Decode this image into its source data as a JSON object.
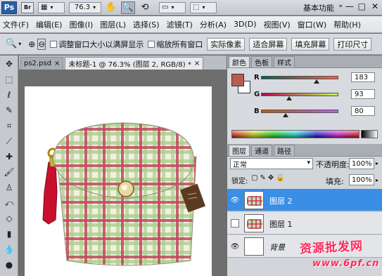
{
  "appbar": {
    "logo": "Ps",
    "bridge": "Br",
    "zoom": "76.3",
    "workspace": "基本功能",
    "minimize": "—",
    "maximize": "□",
    "close": "✕"
  },
  "menu": [
    "文件(F)",
    "编辑(E)",
    "图像(I)",
    "图层(L)",
    "选择(S)",
    "滤镜(T)",
    "分析(A)",
    "3D(D)",
    "视图(V)",
    "窗口(W)",
    "帮助(H)"
  ],
  "options": {
    "check1_label": "调整窗口大小以满屏显示",
    "check2_label": "缩放所有窗口",
    "btn_actual": "实际像素",
    "btn_fit": "适合屏幕",
    "btn_fill": "填充屏幕",
    "btn_print": "打印尺寸"
  },
  "tools": [
    "move-tool",
    "marquee-tool",
    "lasso-tool",
    "quick-select-tool",
    "crop-tool",
    "eyedropper-tool",
    "healing-tool",
    "brush-tool",
    "clone-stamp-tool",
    "history-brush-tool",
    "eraser-tool",
    "gradient-tool",
    "blur-tool",
    "dodge-tool"
  ],
  "doc_tabs": [
    {
      "label": "ps2.psd"
    },
    {
      "label": "未标题-1 @ 76.3% (图层 2, RGB/8) *"
    }
  ],
  "color_panel": {
    "tabs": [
      "颜色",
      "色板",
      "样式"
    ],
    "foreground": "#b75d50",
    "background": "#ffffff",
    "r_label": "R",
    "r_value": "183",
    "r_fraction": 0.718,
    "g_label": "G",
    "g_value": "93",
    "g_fraction": 0.365,
    "b_label": "B",
    "b_value": "80",
    "b_fraction": 0.314
  },
  "layers_panel": {
    "tabs": [
      "图层",
      "通道",
      "路径"
    ],
    "blend_mode": "正常",
    "opacity_label": "不透明度:",
    "opacity": "100%",
    "lock_label": "锁定:",
    "fill_label": "填充:",
    "fill": "100%",
    "layers": [
      {
        "name": "图层 2",
        "visible": true,
        "selected": true
      },
      {
        "name": "图层 1",
        "visible": false,
        "selected": false
      },
      {
        "name": "背景",
        "visible": true,
        "selected": false
      }
    ]
  },
  "watermark": {
    "text": "资源批发网",
    "url": "www.6pf.cn"
  }
}
